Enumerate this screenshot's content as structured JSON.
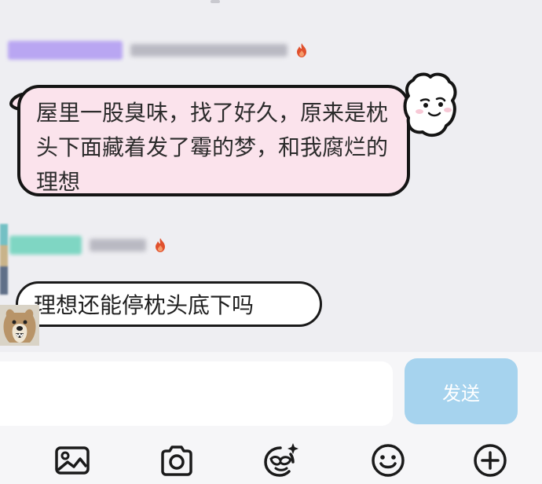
{
  "chat": {
    "messages": [
      {
        "text": "屋里一股臭味，找了好久，原来是枕头下面藏着发了霉的梦，和我腐烂的理想"
      },
      {
        "text": "理想还能停枕头底下吗"
      }
    ]
  },
  "composer": {
    "input_value": "",
    "send_label": "发送"
  },
  "toolbar": {
    "icons": [
      "image-icon",
      "camera-icon",
      "sticker-icon",
      "emoji-icon",
      "plus-icon"
    ]
  },
  "colors": {
    "bubble_pink": "#fbe3ec",
    "send_button": "#a6d3ee",
    "badge_purple": "#b9a6f2",
    "badge_teal": "#7fd6c3",
    "flame": "#e0502d"
  }
}
